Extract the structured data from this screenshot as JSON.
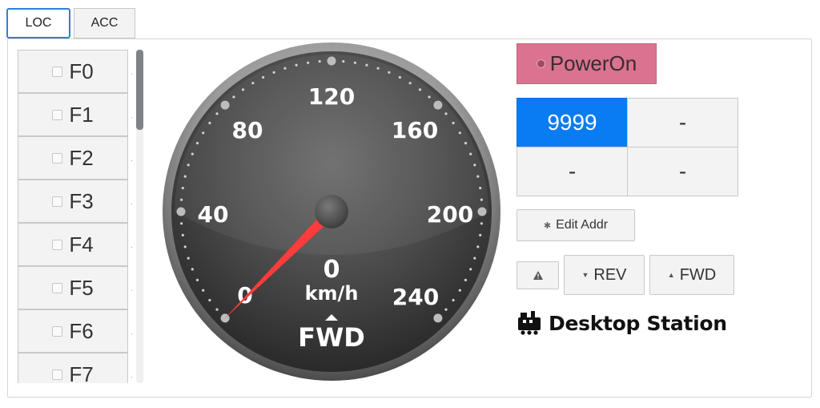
{
  "tabs": [
    {
      "label": "LOC",
      "active": true
    },
    {
      "label": "ACC",
      "active": false
    }
  ],
  "functions": [
    {
      "label": "F0"
    },
    {
      "label": "F1"
    },
    {
      "label": "F2"
    },
    {
      "label": "F3"
    },
    {
      "label": "F4"
    },
    {
      "label": "F5"
    },
    {
      "label": "F6"
    },
    {
      "label": "F7"
    }
  ],
  "gauge": {
    "tick_labels": [
      "0",
      "40",
      "80",
      "120",
      "160",
      "200",
      "240"
    ],
    "speed": "0",
    "unit": "km/h",
    "direction": "FWD",
    "max": 240,
    "value": 0
  },
  "controls": {
    "power_label": "PowerOn",
    "power_color": "#d9738f",
    "addresses": [
      "9999",
      "-",
      "-",
      "-"
    ],
    "selected_color": "#0a7cf3",
    "edit_addr_label": "Edit Addr",
    "rev_label": "REV",
    "fwd_label": "FWD"
  },
  "brand": {
    "name": "Desktop Station",
    "icon": "train-icon"
  }
}
